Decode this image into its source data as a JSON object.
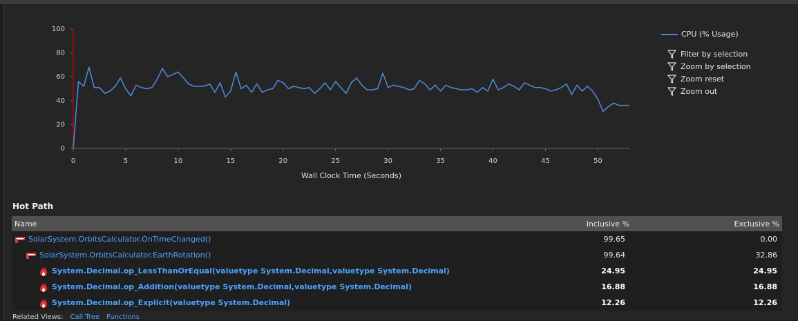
{
  "chart_data": {
    "type": "line",
    "series": [
      {
        "name": "CPU (% Usage)",
        "color": "#4f86d6",
        "x": [
          0,
          0.5,
          1,
          1.5,
          2,
          2.5,
          3,
          3.5,
          4,
          4.5,
          5,
          5.5,
          6,
          6.5,
          7,
          7.5,
          8,
          8.5,
          9,
          9.5,
          10,
          10.5,
          11,
          11.5,
          12,
          12.5,
          13,
          13.5,
          14,
          14.5,
          15,
          15.5,
          16,
          16.5,
          17,
          17.5,
          18,
          18.5,
          19,
          19.5,
          20,
          20.5,
          21,
          21.5,
          22,
          22.5,
          23,
          23.5,
          24,
          24.5,
          25,
          25.5,
          26,
          26.5,
          27,
          27.5,
          28,
          28.5,
          29,
          29.5,
          30,
          30.5,
          31,
          31.5,
          32,
          32.5,
          33,
          33.5,
          34,
          34.5,
          35,
          35.5,
          36,
          36.5,
          37,
          37.5,
          38,
          38.5,
          39,
          39.5,
          40,
          40.5,
          41,
          41.5,
          42,
          42.5,
          43,
          43.5,
          44,
          44.5,
          45,
          45.5,
          46,
          46.5,
          47,
          47.5,
          48,
          48.5,
          49,
          49.5,
          50,
          50.5,
          51,
          51.5,
          52,
          52.5,
          53
        ],
        "values": [
          0,
          56,
          52,
          68,
          51,
          51,
          46,
          48,
          52,
          59,
          50,
          44,
          53,
          51,
          50,
          51,
          58,
          67,
          60,
          62,
          64,
          59,
          54,
          52,
          52,
          52,
          54,
          47,
          55,
          43,
          48,
          64,
          50,
          53,
          47,
          54,
          47,
          49,
          50,
          57,
          55,
          50,
          52,
          51,
          50,
          51,
          46,
          50,
          55,
          49,
          56,
          51,
          46,
          55,
          59,
          53,
          49,
          49,
          50,
          63,
          51,
          53,
          52,
          51,
          49,
          50,
          57,
          54,
          49,
          53,
          48,
          53,
          51,
          50,
          49,
          49,
          50,
          47,
          51,
          48,
          58,
          49,
          51,
          54,
          52,
          49,
          55,
          53,
          51,
          51,
          50,
          48,
          49,
          51,
          54,
          45,
          53,
          48,
          52,
          48,
          41,
          31,
          35,
          38,
          36,
          36,
          36
        ]
      }
    ],
    "xlabel": "Wall Clock Time (Seconds)",
    "ylabel": "",
    "xlim": [
      0,
      53
    ],
    "ylim": [
      0,
      100
    ],
    "xticks": [
      0,
      5,
      10,
      15,
      20,
      25,
      30,
      35,
      40,
      45,
      50
    ],
    "yticks": [
      0,
      20,
      40,
      60,
      80,
      100
    ],
    "selection_marker_x": 0,
    "selection_marker_color": "#cc0000",
    "legend_position": "top-right",
    "grid": false
  },
  "legend": {
    "label": "CPU (% Usage)"
  },
  "actions": [
    {
      "label": "Filter by selection",
      "icon": "filter-icon"
    },
    {
      "label": "Zoom by selection",
      "icon": "funnel-icon"
    },
    {
      "label": "Zoom reset",
      "icon": "funnel-icon"
    },
    {
      "label": "Zoom out",
      "icon": "funnel-icon"
    }
  ],
  "hot_path": {
    "title": "Hot Path",
    "columns": {
      "name": "Name",
      "inclusive": "Inclusive %",
      "exclusive": "Exclusive %"
    },
    "rows": [
      {
        "name": "SolarSystem.OrbitsCalculator.OnTimeChanged()",
        "inclusive": "99.65",
        "exclusive": "0.00",
        "bold": false,
        "indent": 0,
        "icon": "hot-path-icon"
      },
      {
        "name": "SolarSystem.OrbitsCalculator.EarthRotation()",
        "inclusive": "99.64",
        "exclusive": "32.86",
        "bold": false,
        "indent": 1,
        "icon": "hot-path-icon"
      },
      {
        "name": "System.Decimal.op_LessThanOrEqual(valuetype System.Decimal,valuetype System.Decimal)",
        "inclusive": "24.95",
        "exclusive": "24.95",
        "bold": true,
        "indent": 2,
        "icon": "flame-icon"
      },
      {
        "name": "System.Decimal.op_Addition(valuetype System.Decimal,valuetype System.Decimal)",
        "inclusive": "16.88",
        "exclusive": "16.88",
        "bold": true,
        "indent": 2,
        "icon": "flame-icon"
      },
      {
        "name": "System.Decimal.op_Explicit(valuetype System.Decimal)",
        "inclusive": "12.26",
        "exclusive": "12.26",
        "bold": true,
        "indent": 2,
        "icon": "flame-icon"
      }
    ]
  },
  "related": {
    "label": "Related Views:",
    "links": [
      "Call Tree",
      "Functions"
    ]
  }
}
